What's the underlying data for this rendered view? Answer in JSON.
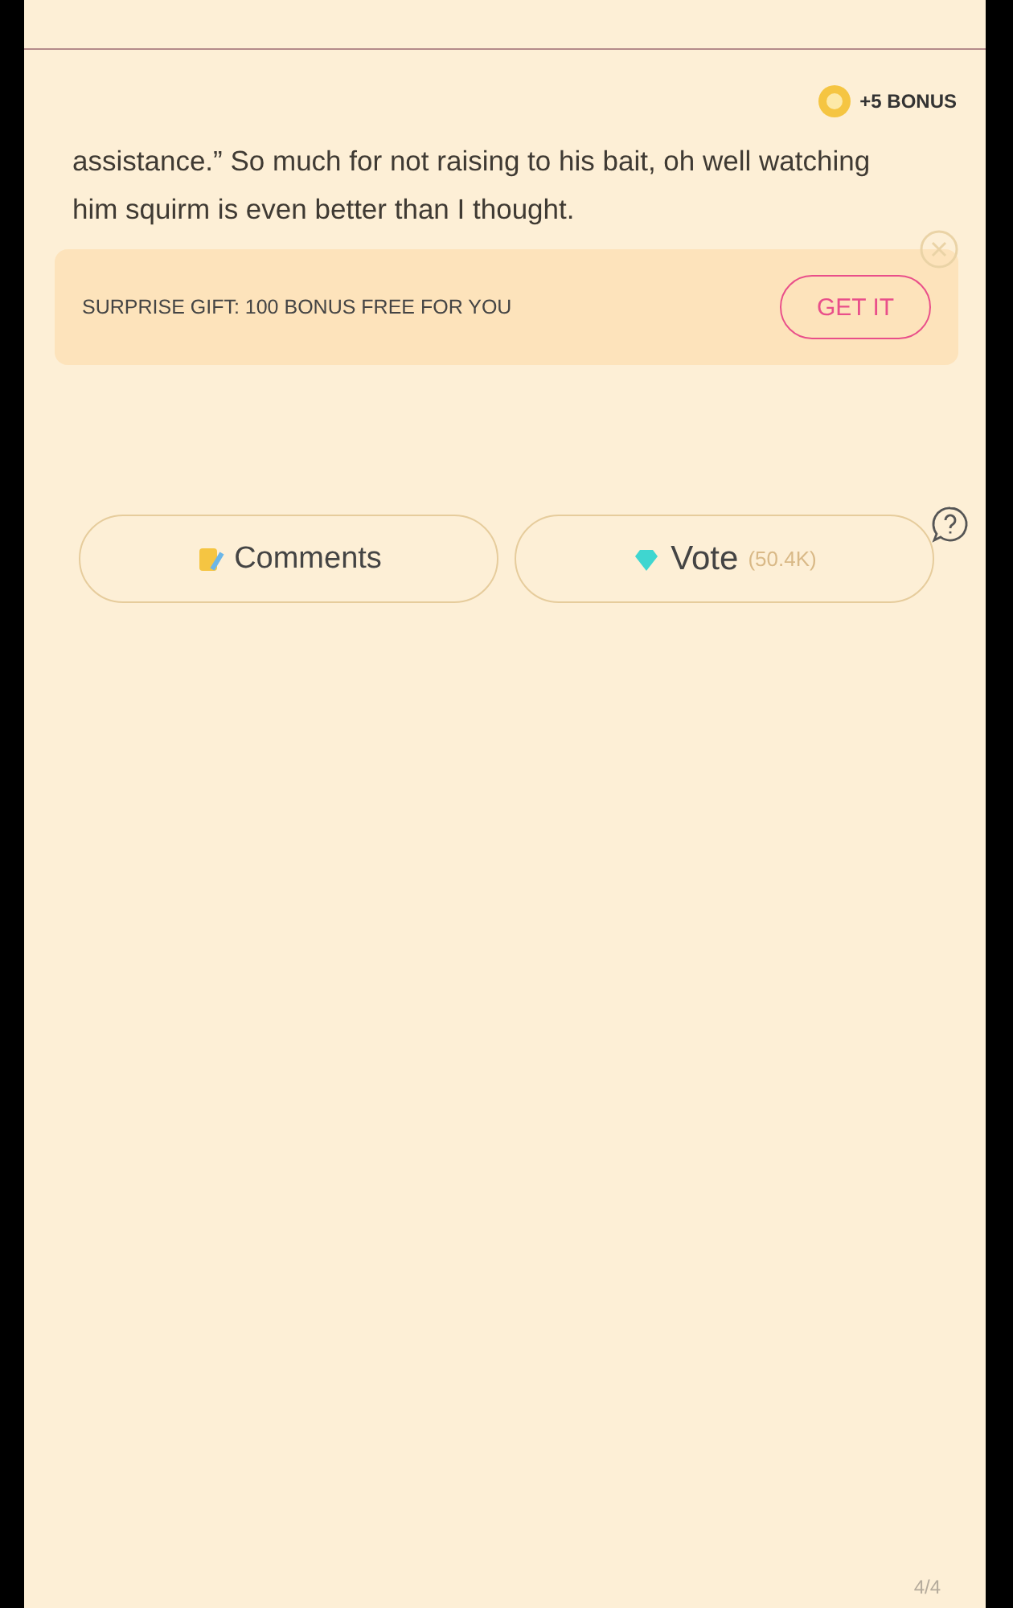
{
  "bonus": {
    "label": "+5 BONUS"
  },
  "text": "assistance.”  So much for not raising to his bait, oh well watching him squirm is even better than I thought.",
  "gift": {
    "text": "SURPRISE GIFT: 100 BONUS FREE FOR YOU",
    "button": "GET IT"
  },
  "actions": {
    "comments": "Comments",
    "vote": "Vote",
    "vote_count": "(50.4K)"
  },
  "page": "4/4"
}
